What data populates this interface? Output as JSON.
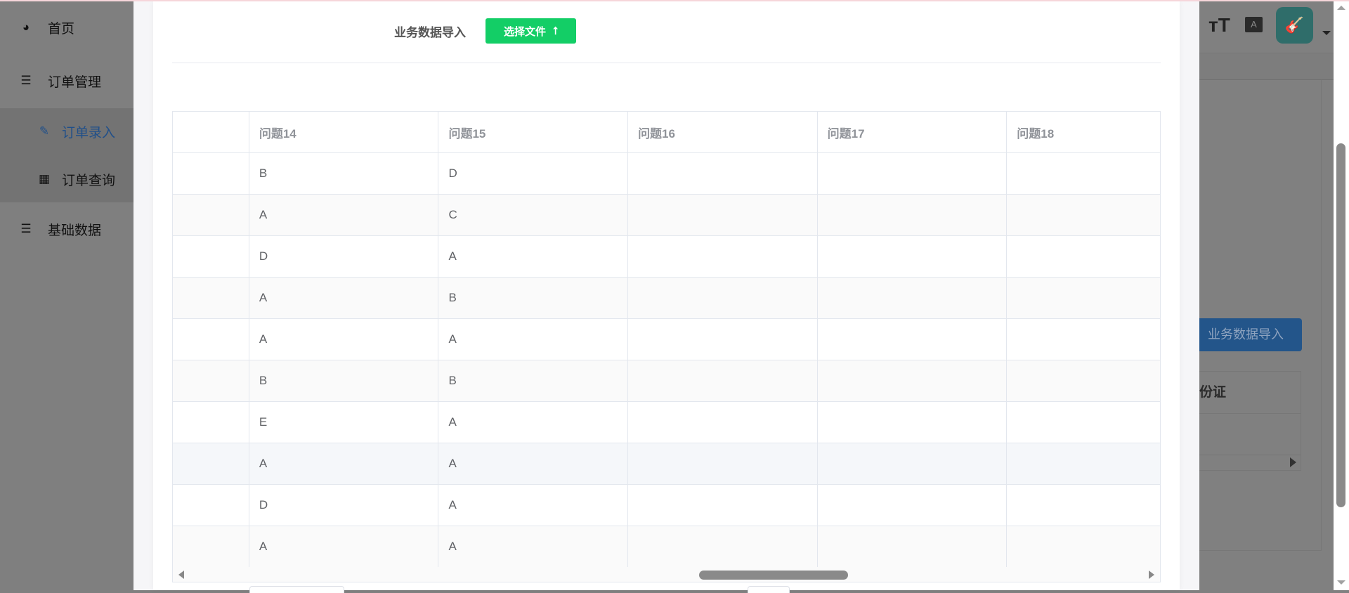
{
  "sidebar": {
    "items": [
      {
        "label": "首页",
        "icon": "dashboard-icon"
      },
      {
        "label": "订单管理",
        "icon": "list-icon"
      },
      {
        "label": "订单录入",
        "icon": "edit-icon"
      },
      {
        "label": "订单查询",
        "icon": "table-icon"
      },
      {
        "label": "基础数据",
        "icon": "list-icon"
      }
    ]
  },
  "background": {
    "import_button": "业务数据导入",
    "table_header": "份证"
  },
  "modal": {
    "import_label": "业务数据导入",
    "choose_file_label": "选择文件",
    "columns": [
      "",
      "问题14",
      "问题15",
      "问题16",
      "问题17",
      "问题18"
    ],
    "rows": [
      [
        "",
        "B",
        "D",
        "",
        "",
        ""
      ],
      [
        "",
        "A",
        "C",
        "",
        "",
        ""
      ],
      [
        "",
        "D",
        "A",
        "",
        "",
        ""
      ],
      [
        "",
        "A",
        "B",
        "",
        "",
        ""
      ],
      [
        "",
        "A",
        "A",
        "",
        "",
        ""
      ],
      [
        "",
        "B",
        "B",
        "",
        "",
        ""
      ],
      [
        "",
        "E",
        "A",
        "",
        "",
        ""
      ],
      [
        "",
        "A",
        "A",
        "",
        "",
        ""
      ],
      [
        "",
        "D",
        "A",
        "",
        "",
        ""
      ],
      [
        "",
        "A",
        "A",
        "",
        "",
        ""
      ]
    ]
  },
  "colors": {
    "accent_green": "#13ce66",
    "active_menu": "#1f4f8a"
  }
}
